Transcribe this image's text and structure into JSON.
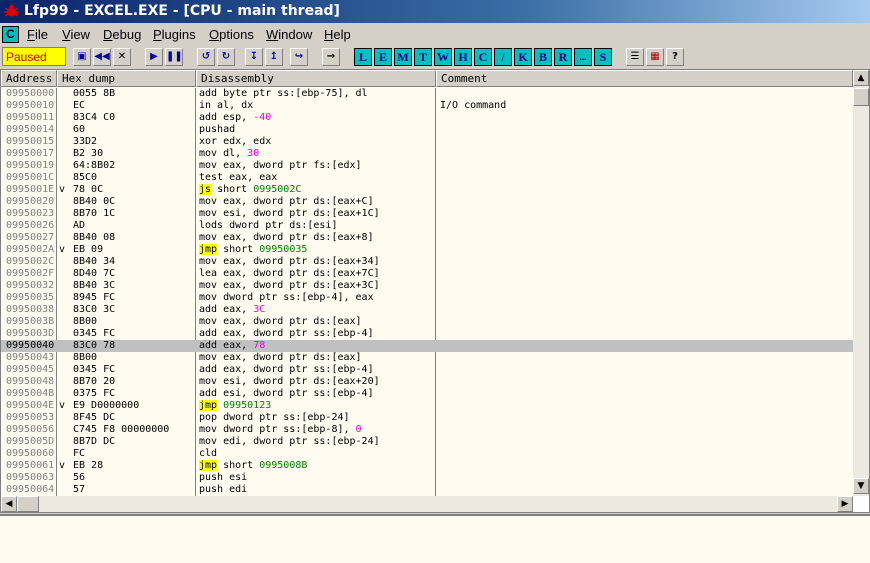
{
  "window": {
    "title": "Lfp99 - EXCEL.EXE - [CPU - main thread]"
  },
  "menu": {
    "cpu_button": "C",
    "items": [
      "File",
      "View",
      "Debug",
      "Plugins",
      "Options",
      "Window",
      "Help"
    ]
  },
  "toolbar": {
    "status": "Paused",
    "letters": [
      "L",
      "E",
      "M",
      "T",
      "W",
      "H",
      "C",
      "/",
      "K",
      "B",
      "R",
      "...",
      "S"
    ]
  },
  "columns": {
    "address": "Address",
    "hex": "Hex dump",
    "disasm": "Disassembly",
    "comment": "Comment"
  },
  "rows": [
    {
      "addr": "09950000",
      "hex": "0055 8B",
      "parts": [
        {
          "t": "add byte ptr ss:[ebp-75], dl"
        }
      ]
    },
    {
      "addr": "09950010",
      "hex": "EC",
      "parts": [
        {
          "t": "in al, dx"
        }
      ],
      "comment": "I/O command"
    },
    {
      "addr": "09950011",
      "hex": "83C4 C0",
      "parts": [
        {
          "t": "add esp, "
        },
        {
          "t": "-40",
          "c": "num"
        }
      ]
    },
    {
      "addr": "09950014",
      "hex": "60",
      "parts": [
        {
          "t": "pushad"
        }
      ]
    },
    {
      "addr": "09950015",
      "hex": "33D2",
      "parts": [
        {
          "t": "xor edx, edx"
        }
      ]
    },
    {
      "addr": "09950017",
      "hex": "B2 30",
      "parts": [
        {
          "t": "mov dl, "
        },
        {
          "t": "30",
          "c": "num"
        }
      ]
    },
    {
      "addr": "09950019",
      "hex": "64:8B02",
      "parts": [
        {
          "t": "mov eax, dword ptr fs:[edx]"
        }
      ]
    },
    {
      "addr": "0995001C",
      "hex": "85C0",
      "parts": [
        {
          "t": "test eax, eax"
        }
      ]
    },
    {
      "addr": "0995001E",
      "mark": "v",
      "hex": "78 0C",
      "parts": [
        {
          "t": "js",
          "c": "hl"
        },
        {
          "t": " short "
        },
        {
          "t": "0995002C",
          "c": "tgt"
        }
      ]
    },
    {
      "addr": "09950020",
      "hex": "8B40 0C",
      "parts": [
        {
          "t": "mov eax, dword ptr ds:[eax+C]"
        }
      ]
    },
    {
      "addr": "09950023",
      "hex": "8B70 1C",
      "parts": [
        {
          "t": "mov esi, dword ptr ds:[eax+1C]"
        }
      ]
    },
    {
      "addr": "09950026",
      "hex": "AD",
      "parts": [
        {
          "t": "lods dword ptr ds:[esi]"
        }
      ]
    },
    {
      "addr": "09950027",
      "hex": "8B40 08",
      "parts": [
        {
          "t": "mov eax, dword ptr ds:[eax+8]"
        }
      ]
    },
    {
      "addr": "0995002A",
      "mark": "v",
      "hex": "EB 09",
      "parts": [
        {
          "t": "jmp",
          "c": "hl"
        },
        {
          "t": " short "
        },
        {
          "t": "09950035",
          "c": "tgt"
        }
      ]
    },
    {
      "addr": "0995002C",
      "hex": "8B40 34",
      "parts": [
        {
          "t": "mov eax, dword ptr ds:[eax+34]"
        }
      ]
    },
    {
      "addr": "0995002F",
      "hex": "8D40 7C",
      "parts": [
        {
          "t": "lea eax, dword ptr ds:[eax+7C]"
        }
      ]
    },
    {
      "addr": "09950032",
      "hex": "8B40 3C",
      "parts": [
        {
          "t": "mov eax, dword ptr ds:[eax+3C]"
        }
      ]
    },
    {
      "addr": "09950035",
      "hex": "8945 FC",
      "parts": [
        {
          "t": "mov dword ptr ss:[ebp-4], eax"
        }
      ]
    },
    {
      "addr": "09950038",
      "hex": "83C0 3C",
      "parts": [
        {
          "t": "add eax, "
        },
        {
          "t": "3C",
          "c": "num"
        }
      ]
    },
    {
      "addr": "0995003B",
      "hex": "8B00",
      "parts": [
        {
          "t": "mov eax, dword ptr ds:[eax]"
        }
      ]
    },
    {
      "addr": "0995003D",
      "hex": "0345 FC",
      "parts": [
        {
          "t": "add eax, dword ptr ss:[ebp-4]"
        }
      ]
    },
    {
      "addr": "09950040",
      "hex": "83C0 78",
      "parts": [
        {
          "t": "add eax, "
        },
        {
          "t": "78",
          "c": "num"
        }
      ],
      "selected": true
    },
    {
      "addr": "09950043",
      "hex": "8B00",
      "parts": [
        {
          "t": "mov eax, dword ptr ds:[eax]"
        }
      ]
    },
    {
      "addr": "09950045",
      "hex": "0345 FC",
      "parts": [
        {
          "t": "add eax, dword ptr ss:[ebp-4]"
        }
      ]
    },
    {
      "addr": "09950048",
      "hex": "8B70 20",
      "parts": [
        {
          "t": "mov esi, dword ptr ds:[eax+20]"
        }
      ]
    },
    {
      "addr": "0995004B",
      "hex": "0375 FC",
      "parts": [
        {
          "t": "add esi, dword ptr ss:[ebp-4]"
        }
      ]
    },
    {
      "addr": "0995004E",
      "mark": "v",
      "hex": "E9 D0000000",
      "parts": [
        {
          "t": "jmp",
          "c": "hl"
        },
        {
          "t": " "
        },
        {
          "t": "09950123",
          "c": "tgt"
        }
      ]
    },
    {
      "addr": "09950053",
      "hex": "8F45 DC",
      "parts": [
        {
          "t": "pop dword ptr ss:[ebp-24]"
        }
      ]
    },
    {
      "addr": "09950056",
      "hex": "C745 F8 00000000",
      "parts": [
        {
          "t": "mov dword ptr ss:[ebp-8], "
        },
        {
          "t": "0",
          "c": "num"
        }
      ]
    },
    {
      "addr": "0995005D",
      "hex": "8B7D DC",
      "parts": [
        {
          "t": "mov edi, dword ptr ss:[ebp-24]"
        }
      ]
    },
    {
      "addr": "09950060",
      "hex": "FC",
      "parts": [
        {
          "t": "cld"
        }
      ]
    },
    {
      "addr": "09950061",
      "mark": "v",
      "hex": "EB 28",
      "parts": [
        {
          "t": "jmp",
          "c": "hl"
        },
        {
          "t": " short "
        },
        {
          "t": "0995008B",
          "c": "tgt"
        }
      ]
    },
    {
      "addr": "09950063",
      "hex": "56",
      "parts": [
        {
          "t": "push esi"
        }
      ]
    },
    {
      "addr": "09950064",
      "hex": "57",
      "parts": [
        {
          "t": "push edi"
        }
      ]
    }
  ],
  "colors": {
    "num": "#e000e0",
    "tgt": "#008000",
    "hl": "#ffff00",
    "selection": "#c0c0c0",
    "status_bg": "#ffff00",
    "status_fg": "#d00000"
  }
}
